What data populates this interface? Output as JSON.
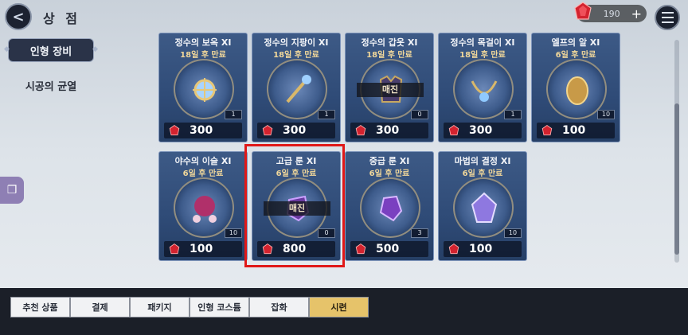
{
  "header": {
    "title": "상 점"
  },
  "currency": {
    "amount": "190",
    "plus": "+",
    "icon": "red-gem-icon"
  },
  "sidebar": {
    "active": "인형 장비",
    "item": "시공의 균열"
  },
  "items": [
    {
      "name": "정수의 보옥 XI",
      "sub": "18일 후 만료",
      "qty": "1",
      "price": "300",
      "soldout": ""
    },
    {
      "name": "정수의 지팡이 XI",
      "sub": "18일 후 만료",
      "qty": "1",
      "price": "300",
      "soldout": ""
    },
    {
      "name": "정수의 갑옷 XI",
      "sub": "18일 후 만료",
      "qty": "0",
      "price": "300",
      "soldout": "매진"
    },
    {
      "name": "정수의 목걸이 XI",
      "sub": "18일 후 만료",
      "qty": "1",
      "price": "300",
      "soldout": ""
    },
    {
      "name": "엘프의 알 XI",
      "sub": "6일 후 만료",
      "qty": "10",
      "price": "100",
      "soldout": ""
    },
    {
      "name": "야수의 이슬 XI",
      "sub": "6일 후 만료",
      "qty": "10",
      "price": "100",
      "soldout": ""
    },
    {
      "name": "고급 룬 XI",
      "sub": "6일 후 만료",
      "qty": "0",
      "price": "800",
      "soldout": "매진"
    },
    {
      "name": "중급 룬 XI",
      "sub": "6일 후 만료",
      "qty": "3",
      "price": "500",
      "soldout": ""
    },
    {
      "name": "마법의 결정 XI",
      "sub": "6일 후 만료",
      "qty": "10",
      "price": "100",
      "soldout": ""
    }
  ],
  "tabs": [
    {
      "label": "추천 상품"
    },
    {
      "label": "결제"
    },
    {
      "label": "패키지"
    },
    {
      "label": "인형 코스튬"
    },
    {
      "label": "잡화"
    },
    {
      "label": "시련"
    }
  ],
  "colors": {
    "accent_tab": "#e6c36a",
    "highlight": "#e01818",
    "card": "#2f4b77"
  }
}
